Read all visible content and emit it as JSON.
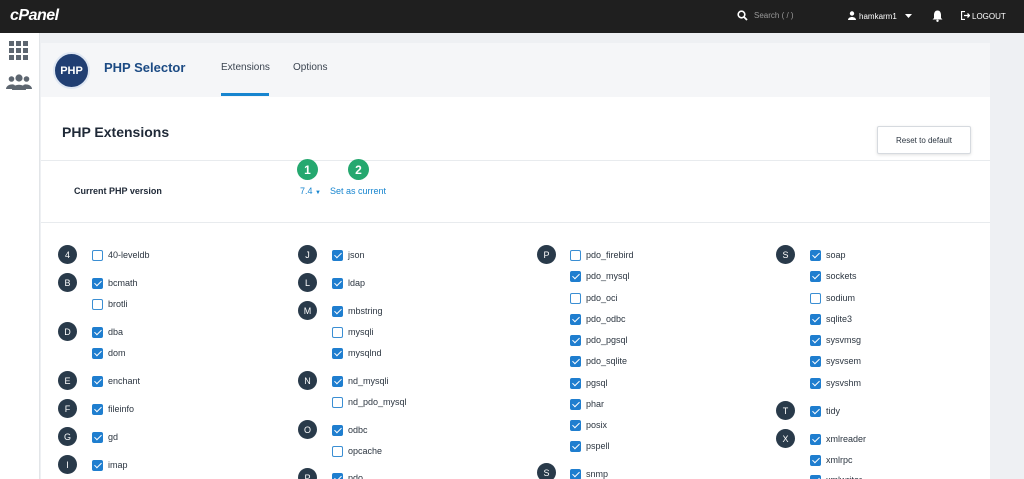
{
  "topbar": {
    "logo": "cPanel",
    "search_placeholder": "Search ( / )",
    "username": "hamkarm1",
    "logout_label": "LOGOUT"
  },
  "header": {
    "app_title": "PHP Selector",
    "tabs": [
      {
        "label": "Extensions",
        "active": true
      },
      {
        "label": "Options",
        "active": false
      }
    ],
    "logo_text": "PHP"
  },
  "main": {
    "section_title": "PHP Extensions",
    "reset_label": "Reset to default",
    "version_label": "Current PHP version",
    "version_value": "7.4",
    "set_current_label": "Set as current",
    "callouts": [
      "1",
      "2"
    ]
  },
  "extensions": {
    "letters": [
      "4",
      "B",
      "D",
      "E",
      "F",
      "G",
      "I",
      "J",
      "L",
      "M",
      "N",
      "O",
      "P",
      "P",
      "S",
      "S",
      "T",
      "X"
    ],
    "items": [
      {
        "name": "40-leveldb",
        "checked": false
      },
      {
        "name": "bcmath",
        "checked": true
      },
      {
        "name": "brotli",
        "checked": false
      },
      {
        "name": "dba",
        "checked": true
      },
      {
        "name": "dom",
        "checked": true
      },
      {
        "name": "enchant",
        "checked": true
      },
      {
        "name": "fileinfo",
        "checked": true
      },
      {
        "name": "gd",
        "checked": true
      },
      {
        "name": "imap",
        "checked": true
      },
      {
        "name": "json",
        "checked": true
      },
      {
        "name": "ldap",
        "checked": true
      },
      {
        "name": "mbstring",
        "checked": true
      },
      {
        "name": "mysqli",
        "checked": false
      },
      {
        "name": "mysqlnd",
        "checked": true
      },
      {
        "name": "nd_mysqli",
        "checked": true
      },
      {
        "name": "nd_pdo_mysql",
        "checked": false
      },
      {
        "name": "odbc",
        "checked": true
      },
      {
        "name": "opcache",
        "checked": false
      },
      {
        "name": "pdo",
        "checked": true
      },
      {
        "name": "pdo_firebird",
        "checked": false
      },
      {
        "name": "pdo_mysql",
        "checked": true
      },
      {
        "name": "pdo_oci",
        "checked": false
      },
      {
        "name": "pdo_odbc",
        "checked": true
      },
      {
        "name": "pdo_pgsql",
        "checked": true
      },
      {
        "name": "pdo_sqlite",
        "checked": true
      },
      {
        "name": "pgsql",
        "checked": true
      },
      {
        "name": "phar",
        "checked": true
      },
      {
        "name": "posix",
        "checked": true
      },
      {
        "name": "pspell",
        "checked": true
      },
      {
        "name": "snmp",
        "checked": true
      },
      {
        "name": "soap",
        "checked": true
      },
      {
        "name": "sockets",
        "checked": true
      },
      {
        "name": "sodium",
        "checked": false
      },
      {
        "name": "sqlite3",
        "checked": true
      },
      {
        "name": "sysvmsg",
        "checked": true
      },
      {
        "name": "sysvsem",
        "checked": true
      },
      {
        "name": "sysvshm",
        "checked": true
      },
      {
        "name": "tidy",
        "checked": true
      },
      {
        "name": "xmlreader",
        "checked": true
      },
      {
        "name": "xmlrpc",
        "checked": true
      },
      {
        "name": "xmlwriter",
        "checked": true
      }
    ]
  },
  "colors": {
    "topbar": "#1f1f1f",
    "accent": "#1785cf",
    "callout": "#25a86f",
    "letter_badge": "#293a4a"
  }
}
